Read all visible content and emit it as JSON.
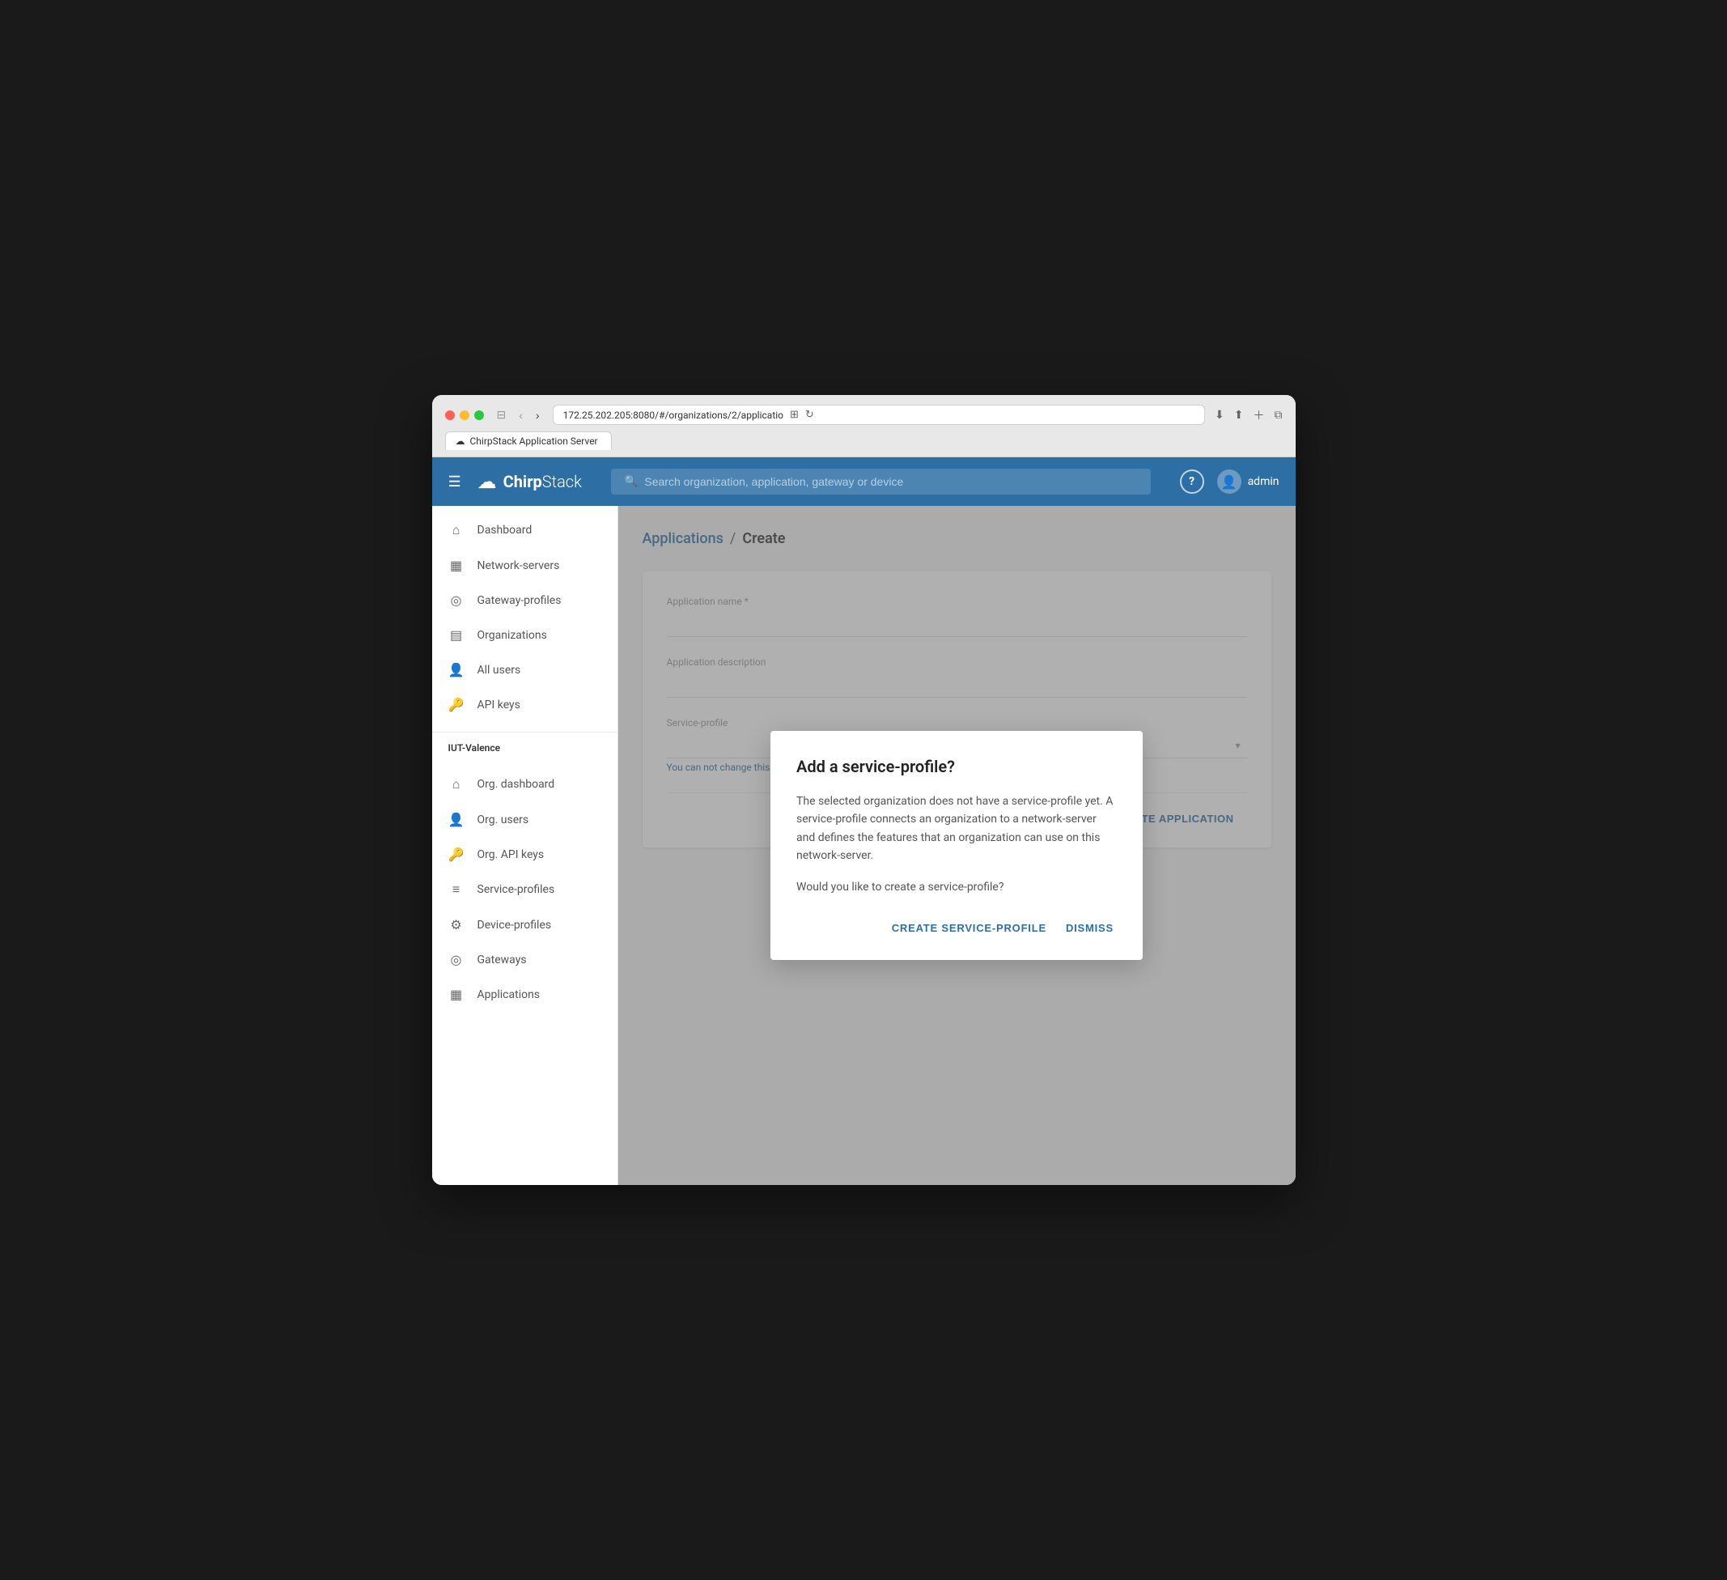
{
  "browser": {
    "url": "172.25.202.205:8080/#/organizations/2/applicatio",
    "tab_label": "ChirpStack Application Server",
    "tab_icon": "☁"
  },
  "topnav": {
    "logo_chirp": "Chirp",
    "logo_stack": "Stack",
    "search_placeholder": "Search organization, application, gateway or device",
    "user_label": "admin"
  },
  "sidebar": {
    "global_items": [
      {
        "icon": "⌂",
        "label": "Dashboard"
      },
      {
        "icon": "▦",
        "label": "Network-servers"
      },
      {
        "icon": "◎",
        "label": "Gateway-profiles"
      },
      {
        "icon": "▤",
        "label": "Organizations"
      },
      {
        "icon": "👤",
        "label": "All users"
      },
      {
        "icon": "🔑",
        "label": "API keys"
      }
    ],
    "org_name": "IUT-Valence",
    "org_items": [
      {
        "icon": "⌂",
        "label": "Org. dashboard"
      },
      {
        "icon": "👤",
        "label": "Org. users"
      },
      {
        "icon": "🔑",
        "label": "Org. API keys"
      },
      {
        "icon": "≡",
        "label": "Service-profiles"
      },
      {
        "icon": "⚙",
        "label": "Device-profiles"
      },
      {
        "icon": "◎",
        "label": "Gateways"
      },
      {
        "icon": "▦",
        "label": "Applications"
      }
    ]
  },
  "breadcrumb": {
    "link": "Applications",
    "separator": "/",
    "current": "Create"
  },
  "form": {
    "app_name_label": "Application name *",
    "app_name_placeholder": "",
    "description_label": "Application description",
    "description_placeholder": "",
    "service_profile_label": "Service-profile",
    "service_profile_hint": "You can not change this value",
    "create_btn": "CREATE APPLICATION"
  },
  "dialog": {
    "title": "Add a service-profile?",
    "body_line1": "The selected organization does not have a service-profile yet. A service-profile connects an organization to a network-server and defines the features that an organization can use on this network-server.",
    "body_line2": "Would you like to create a service-profile?",
    "create_btn": "CREATE SERVICE-PROFILE",
    "dismiss_btn": "DISMISS"
  }
}
